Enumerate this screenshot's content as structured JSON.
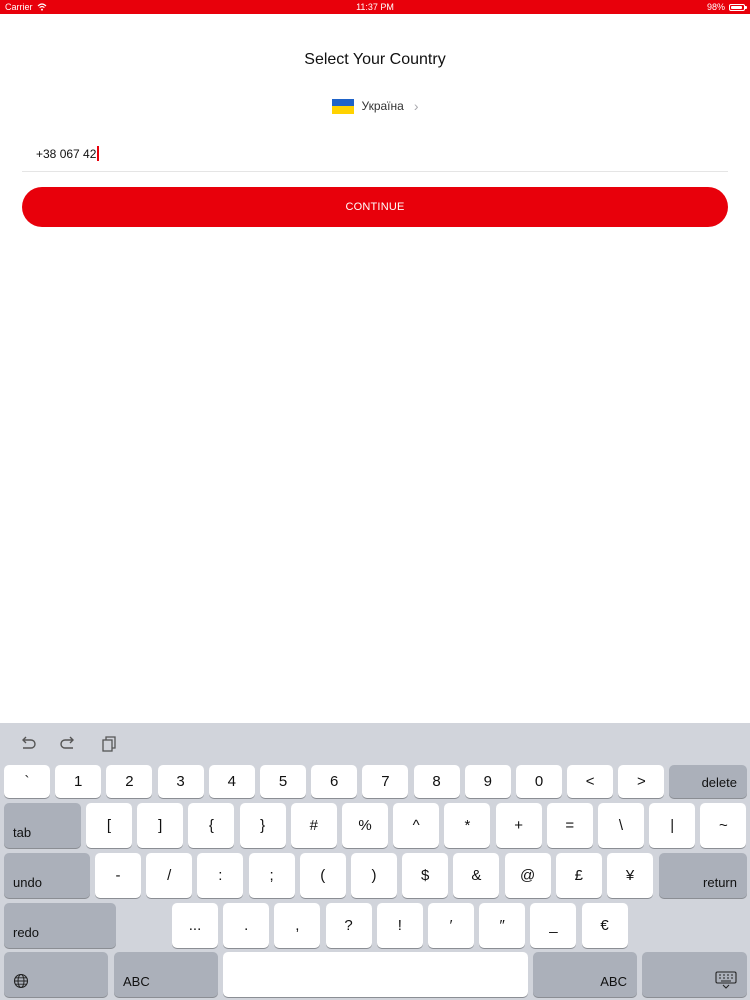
{
  "status_bar": {
    "carrier": "Carrier",
    "time": "11:37 PM",
    "battery": "98%",
    "color": "#e8000b"
  },
  "screen": {
    "title": "Select Your Country",
    "country": {
      "name": "Україна",
      "flag_icon": "ukraine-flag-icon"
    },
    "phone_value": "+38 067 42",
    "continue_label": "CONTINUE"
  },
  "keyboard": {
    "toolbar": [
      "undo-icon",
      "redo-icon",
      "paste-icon"
    ],
    "row1": [
      "`",
      "1",
      "2",
      "3",
      "4",
      "5",
      "6",
      "7",
      "8",
      "9",
      "0",
      "<",
      ">"
    ],
    "row1_delete": "delete",
    "row2_tab": "tab",
    "row2": [
      "[",
      "]",
      "{",
      "}",
      "#",
      "%",
      "^",
      "*",
      "+",
      "=",
      "\\",
      "|",
      "~"
    ],
    "row3_undo": "undo",
    "row3": [
      "-",
      "/",
      ":",
      ";",
      "(",
      ")",
      "$",
      "&",
      "@",
      "£",
      "¥"
    ],
    "row3_return": "return",
    "row4_redo": "redo",
    "row4": [
      "...",
      ".",
      ",",
      "?",
      "!",
      "′",
      "″",
      "_",
      "€"
    ],
    "row5_abc_left": "ABC",
    "row5_abc_right": "ABC",
    "row5_icons": [
      "globe-icon",
      "keyboard-dismiss-icon"
    ]
  }
}
